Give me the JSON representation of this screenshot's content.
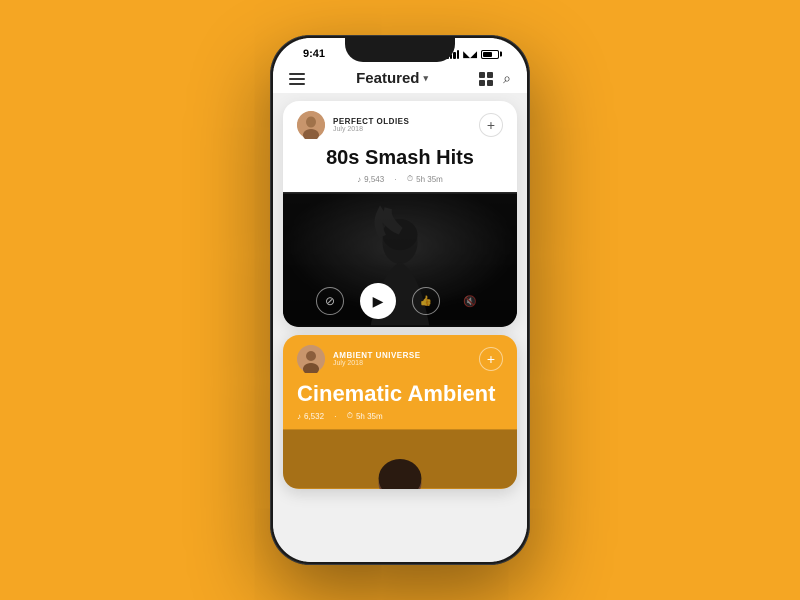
{
  "statusBar": {
    "time": "9:41",
    "timeLabel": "status-time"
  },
  "navbar": {
    "menuIcon": "hamburger",
    "title": "Featured",
    "chevron": "▾",
    "gridIcon": "grid",
    "searchIcon": "🔍"
  },
  "card1": {
    "userName": "PERFECT OLDIES",
    "userDate": "July 2018",
    "addLabel": "+",
    "title": "80s Smash Hits",
    "metaLikes": "9,543",
    "metaDuration": "5h 35m",
    "likeIcon": "♪",
    "clockIcon": "⏱"
  },
  "card2": {
    "userName": "AMBIENT UNIVERSE",
    "userDate": "July 2018",
    "addLabel": "+",
    "title": "Cinematic Ambient",
    "metaLikes": "6,532",
    "metaDuration": "5h 35m",
    "likeIcon": "♪",
    "clockIcon": "⏱"
  },
  "controls": {
    "blockIcon": "⊘",
    "playIcon": "▶",
    "likeIcon": "👍",
    "muteIcon": "🔇"
  }
}
